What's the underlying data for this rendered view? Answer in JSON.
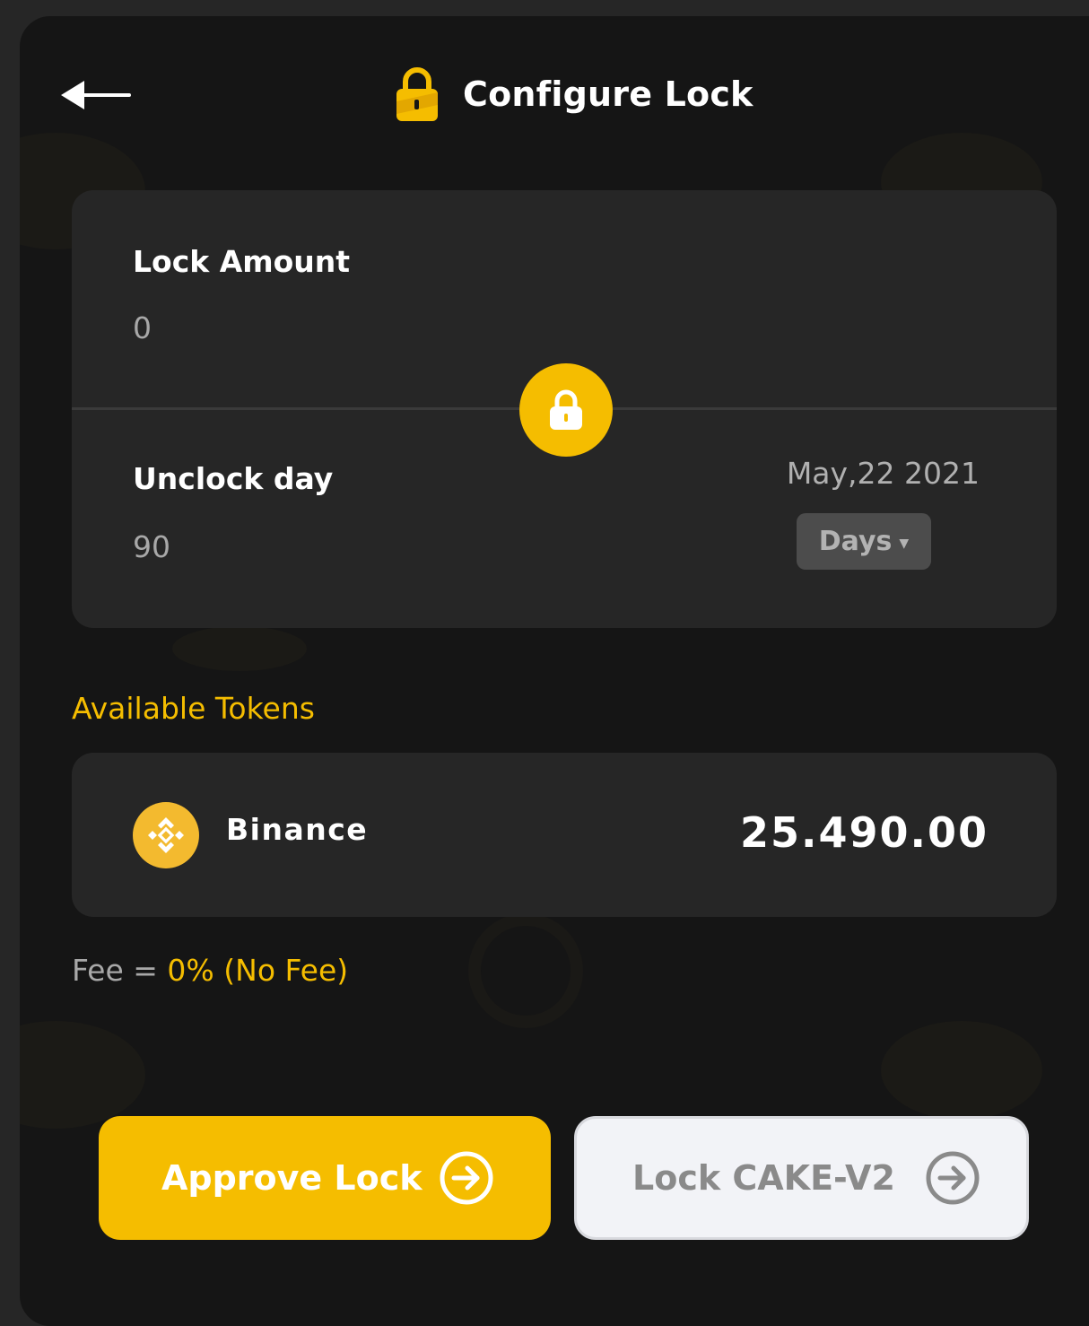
{
  "header": {
    "title": "Configure Lock",
    "back_icon": "back-arrow-icon",
    "title_icon": "padlock-icon"
  },
  "lock_card": {
    "amount_label": "Lock Amount",
    "amount_value": "0",
    "unlock_label": "Unclock day",
    "unlock_value": "90",
    "unlock_date": "May,22 2021",
    "unit_select": "Days",
    "center_icon": "lock-icon"
  },
  "tokens": {
    "section_title": "Available Tokens",
    "items": [
      {
        "name": "Binance",
        "balance": "25.490.00",
        "icon": "binance-icon"
      }
    ]
  },
  "fee": {
    "label": "Fee = ",
    "value": "0% (No Fee)"
  },
  "actions": {
    "approve_label": "Approve Lock",
    "lock_label": "Lock CAKE-V2"
  },
  "colors": {
    "accent": "#f5bd00",
    "background": "#151515",
    "card": "#262626"
  }
}
